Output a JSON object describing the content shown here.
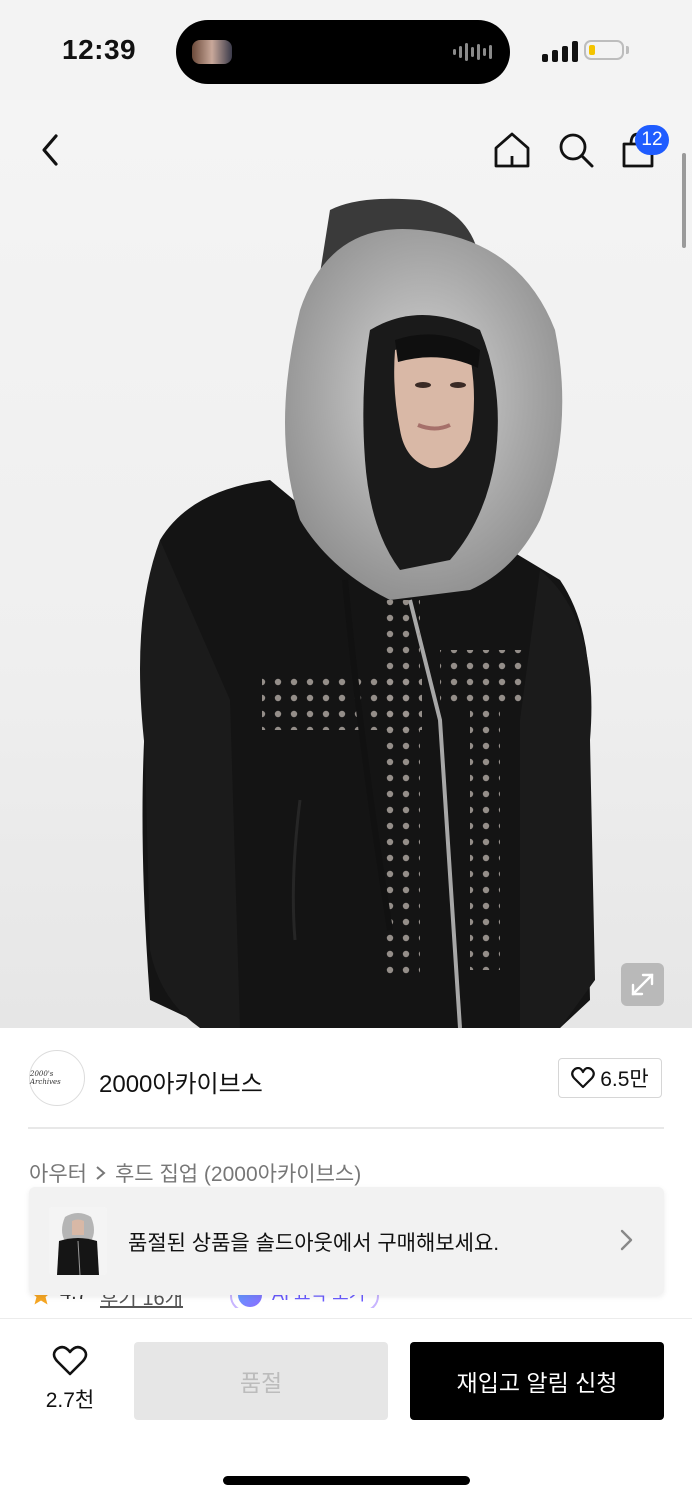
{
  "status_bar": {
    "time": "12:39"
  },
  "header": {
    "icons": [
      "back-icon",
      "home-icon",
      "search-icon",
      "cart-icon"
    ],
    "cart_count": "12"
  },
  "brand": {
    "logo_text": "2000's Archives",
    "name": "2000아카이브스",
    "likes": "6.5만"
  },
  "breadcrumb": {
    "category": "아우터",
    "subcategory": "후드 집업 (2000아카이브스)"
  },
  "rating": {
    "score": "4.7",
    "reviews": "후기 16개",
    "ai_label": "AI 요약 보기"
  },
  "soldout_banner": {
    "text": "품절된 상품을 솔드아웃에서 구매해보세요."
  },
  "bottom": {
    "wish_count": "2.7천",
    "soldout_label": "품절",
    "restock_label": "재입고 알림 신청"
  },
  "colors": {
    "accent": "#1f5cff",
    "primary_button": "#000000",
    "disabled_button": "#e6e6e6"
  }
}
